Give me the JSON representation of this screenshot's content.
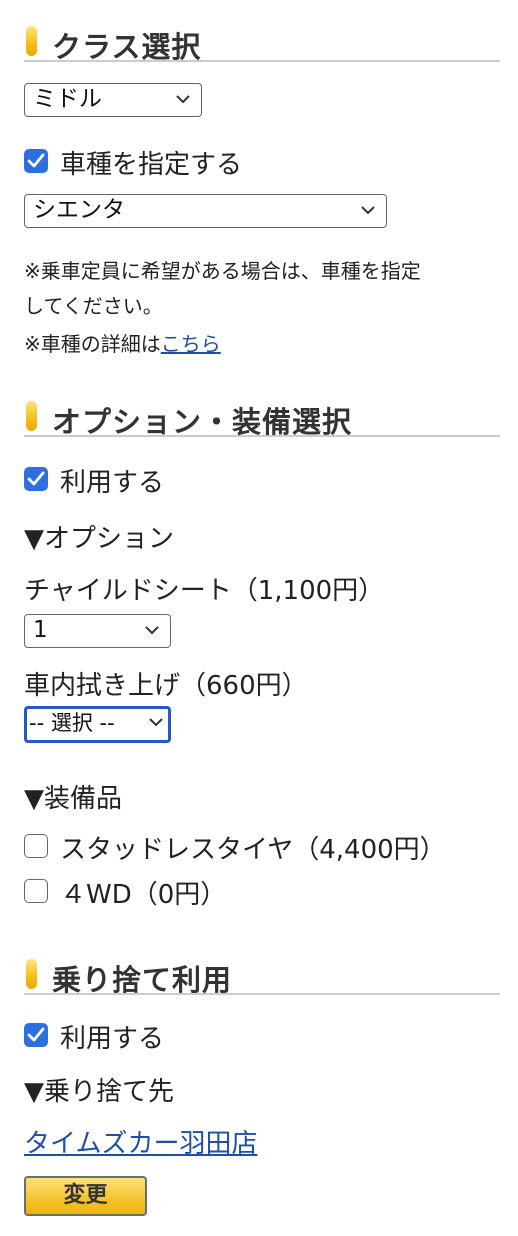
{
  "class_section": {
    "title": "クラス選択",
    "class_select": {
      "value": "ミドル"
    },
    "specify_model": {
      "label": "車種を指定する",
      "checked": true
    },
    "model_select": {
      "value": "シエンタ"
    },
    "note_line1": "※乗車定員に希望がある場合は、車種を指定",
    "note_line2": "してください。",
    "note_line3_prefix": "※車種の詳細は",
    "note_line3_link": "こちら"
  },
  "option_section": {
    "title": "オプション・装備選択",
    "use": {
      "label": "利用する",
      "checked": true
    },
    "options_heading": "▼オプション",
    "child_seat": {
      "label": "チャイルドシート（1,100円）",
      "value": "1"
    },
    "interior_wipe": {
      "label": "車内拭き上げ（660円）",
      "value": "-- 選択 --"
    },
    "equipment_heading": "▼装備品",
    "studless": {
      "label": "スタッドレスタイヤ（4,400円）",
      "checked": false
    },
    "fourwd": {
      "label": "４WD（0円）",
      "checked": false
    }
  },
  "dropoff_section": {
    "title": "乗り捨て利用",
    "use": {
      "label": "利用する",
      "checked": true
    },
    "destination_heading": "▼乗り捨て先",
    "destination_link": "タイムズカー羽田店",
    "change_button": "変更"
  },
  "colors": {
    "accent_yellow": "#f5c21b",
    "checkbox_blue": "#2d6ee0",
    "link_blue": "#1f4fa6",
    "focus_blue": "#2458c8"
  }
}
